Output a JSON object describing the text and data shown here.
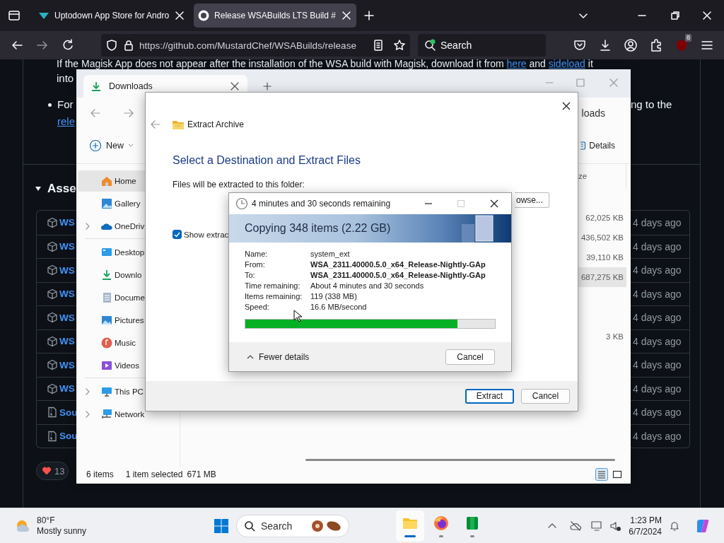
{
  "browser": {
    "tabs": [
      {
        "kind": "uptodown",
        "title": "Uptodown App Store for Andro",
        "selected": false
      },
      {
        "kind": "github",
        "title": "Release WSABuilds LTS Build #",
        "selected": true
      }
    ],
    "url": "https://github.com/MustardChef/WSABuilds/release",
    "search_placeholder": "Search",
    "extension_badge": "8"
  },
  "page": {
    "intro_line": [
      {
        "kind": "text",
        "text": "If the Magisk App does not appear after the installation of the WSA build with Magisk, download it from "
      },
      {
        "kind": "link",
        "text": "here"
      },
      {
        "kind": "text",
        "text": " and "
      },
      {
        "kind": "link",
        "text": "sideload"
      },
      {
        "kind": "text",
        "text": " it"
      }
    ],
    "intro_line_2": "into",
    "bullet_start": "For",
    "bullet_link": "rele",
    "bullet_end": "ng to the",
    "assets_heading": "Asse",
    "assets": [
      {
        "kind": "package",
        "name": "WS",
        "date": "4 days ago"
      },
      {
        "kind": "package",
        "name": "WS",
        "date": "4 days ago"
      },
      {
        "kind": "package",
        "name": "WS",
        "date": "4 days ago"
      },
      {
        "kind": "package",
        "name": "WS",
        "date": "4 days ago"
      },
      {
        "kind": "package",
        "name": "WS",
        "date": "4 days ago"
      },
      {
        "kind": "package",
        "name": "WS",
        "date": "4 days ago"
      },
      {
        "kind": "package",
        "name": "WS",
        "date": "4 days ago"
      },
      {
        "kind": "package",
        "name": "WS",
        "date": "4 days ago"
      },
      {
        "kind": "source",
        "name": "Sou",
        "date": "4 days ago"
      },
      {
        "kind": "source",
        "name": "Sou",
        "date": "4 days ago"
      }
    ],
    "reactions": "13"
  },
  "explorer": {
    "tab": "Downloads",
    "address": "loads",
    "new_label": "New",
    "details_label": "Details",
    "sidebar_groups": [
      {
        "items": [
          {
            "kind": "home",
            "label": "Home",
            "selected": true,
            "expandable": false
          },
          {
            "kind": "gallery",
            "label": "Gallery",
            "selected": false,
            "expandable": false
          },
          {
            "kind": "onedrive",
            "label": "OneDriv",
            "selected": false,
            "expandable": true
          }
        ]
      },
      {
        "items": [
          {
            "kind": "desktop",
            "label": "Desktop",
            "selected": false,
            "expandable": false
          },
          {
            "kind": "downloads",
            "label": "Downlo",
            "selected": false,
            "expandable": false
          },
          {
            "kind": "documents",
            "label": "Docume",
            "selected": false,
            "expandable": false
          },
          {
            "kind": "pictures",
            "label": "Pictures",
            "selected": false,
            "expandable": false
          },
          {
            "kind": "music",
            "label": "Music",
            "selected": false,
            "expandable": false
          },
          {
            "kind": "videos",
            "label": "Videos",
            "selected": false,
            "expandable": false
          }
        ]
      },
      {
        "items": [
          {
            "kind": "pc",
            "label": "This PC",
            "selected": false,
            "expandable": true
          },
          {
            "kind": "network",
            "label": "Network",
            "selected": false,
            "expandable": true
          }
        ]
      }
    ],
    "size_header": "ze",
    "rows": [
      {
        "size": "62,025 KB",
        "selected": false
      },
      {
        "size": "436,502 KB",
        "selected": false
      },
      {
        "size": "39,110 KB",
        "selected": false
      },
      {
        "size": "687,275 KB",
        "selected": true
      },
      {
        "selected": false
      },
      {
        "selected": false
      },
      {
        "size": "3 KB",
        "selected": false
      }
    ],
    "status_count": "6 items",
    "status_selection": "1 item selected",
    "status_size": "671 MB",
    "views": [
      {
        "kind": "details",
        "selected": true
      },
      {
        "kind": "tiles",
        "selected": false
      }
    ]
  },
  "extract": {
    "title": "Extract Archive",
    "heading": "Select a Destination and Extract Files",
    "folder_label": "Files will be extracted to this folder:",
    "browse": "owse...",
    "show_files": {
      "label": "Show extrac",
      "checked": true
    },
    "buttons": [
      {
        "label": "Extract",
        "default": true
      },
      {
        "label": "Cancel",
        "default": false
      }
    ]
  },
  "copy": {
    "title": "4 minutes and 30 seconds remaining",
    "heading": "Copying 348 items (2.22 GB)",
    "details": [
      {
        "label": "Name:",
        "value": "system_ext",
        "bold": false
      },
      {
        "label": "From:",
        "value": "WSA_2311.40000.5.0_x64_Release-Nightly-GAp",
        "bold": true
      },
      {
        "label": "To:",
        "value": "WSA_2311.40000.5.0_x64_Release-Nightly-GAp",
        "bold": true
      },
      {
        "label": "Time remaining:",
        "value": "About 4 minutes and 30 seconds",
        "bold": false
      },
      {
        "label": "Items remaining:",
        "value": "119 (338 MB)",
        "bold": false
      },
      {
        "label": "Speed:",
        "value": "16.6 MB/second",
        "bold": false
      }
    ],
    "level": 0.85,
    "toggle": "Fewer details",
    "cancel": "Cancel"
  },
  "taskbar": {
    "temperature": "80°F",
    "condition": "Mostly sunny",
    "search_placeholder": "Search",
    "apps": [
      {
        "kind": "explorer",
        "active": true
      },
      {
        "kind": "firefox",
        "active": false
      },
      {
        "kind": "green",
        "active": false
      }
    ],
    "time": "1:23 PM",
    "date": "6/7/2024"
  }
}
